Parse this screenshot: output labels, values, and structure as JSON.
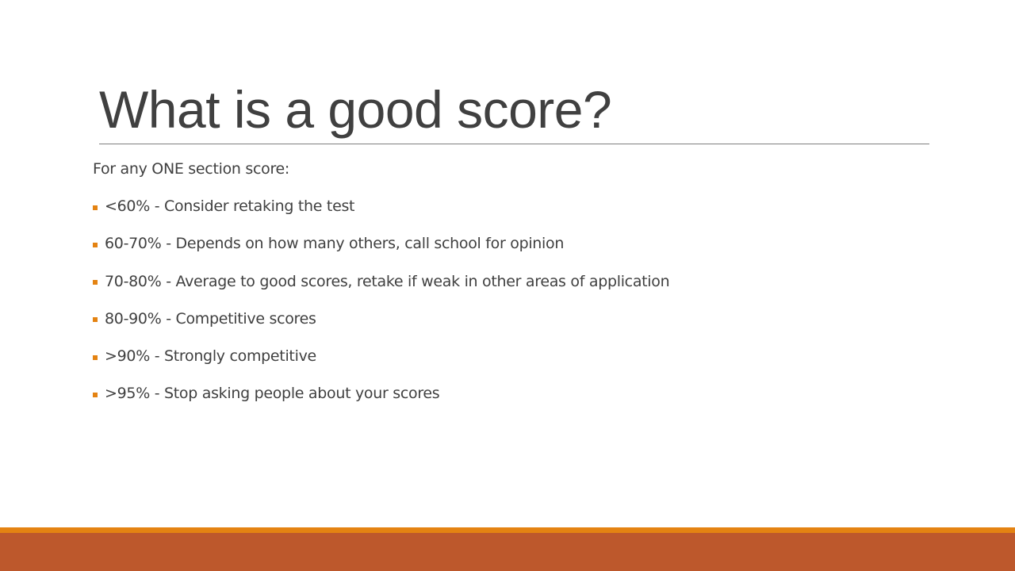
{
  "slide": {
    "title": "What is a good score?",
    "intro": "For any ONE section score:",
    "bullets": [
      {
        "text": "<60% - Consider retaking the test"
      },
      {
        "text": "60-70% - Depends on how many others, call school for opinion"
      },
      {
        "text": "70-80% - Average to good scores, retake if weak in other areas of application"
      },
      {
        "text": "80-90% - Competitive scores"
      },
      {
        "text": ">90% - Strongly competitive"
      },
      {
        "text": ">95% - Stop asking people about your scores"
      }
    ],
    "bullet_icon": "square-bullet-icon"
  },
  "theme": {
    "accent": "#e48312",
    "footer": "#bd582c",
    "text": "#404040",
    "rule": "#7f7f7f"
  }
}
